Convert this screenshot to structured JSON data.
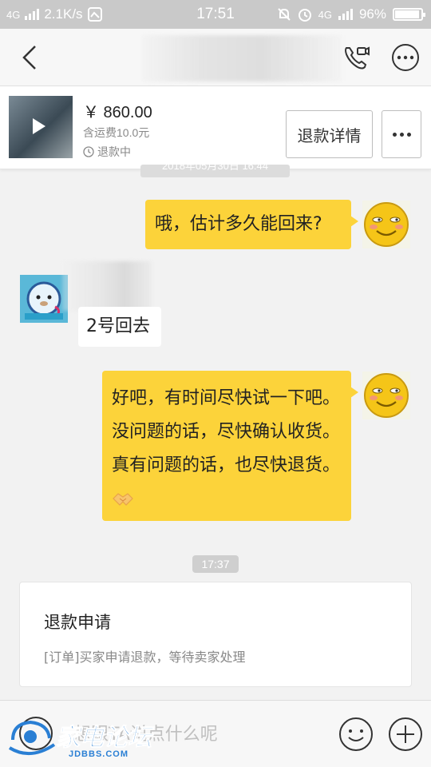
{
  "status_bar": {
    "network": "4G",
    "speed": "2.1K/s",
    "time": "17:51",
    "network_right": "4G",
    "battery": "96%"
  },
  "nav": {
    "back_icon": "chevron-left-icon",
    "call_icon": "phone-video-icon",
    "more_icon": "more-circle-icon"
  },
  "order": {
    "price": "￥ 860.00",
    "shipping": "含运费10.0元",
    "status": "退款中",
    "refund_detail_label": "退款详情"
  },
  "messages": {
    "clipped_timestamp": "2018年05月30日 16:44",
    "msg1": "哦，估计多久能回来?",
    "msg2": "2号回去",
    "msg3": "好吧，有时间尽快试一下吧。没问题的话，尽快确认收货。真有问题的话，也尽快退货。",
    "timestamp2": "17:37"
  },
  "refund_card": {
    "title": "退款申请",
    "desc": "[订单]买家申请退款，等待卖家处理"
  },
  "input": {
    "placeholder": "想跟TA说点什么呢"
  },
  "watermark": {
    "text": "家电论坛",
    "sub": "JDBBS.COM"
  },
  "colors": {
    "self_bubble": "#fcd33a",
    "other_bubble": "#ffffff",
    "background": "#f2f2f2"
  }
}
